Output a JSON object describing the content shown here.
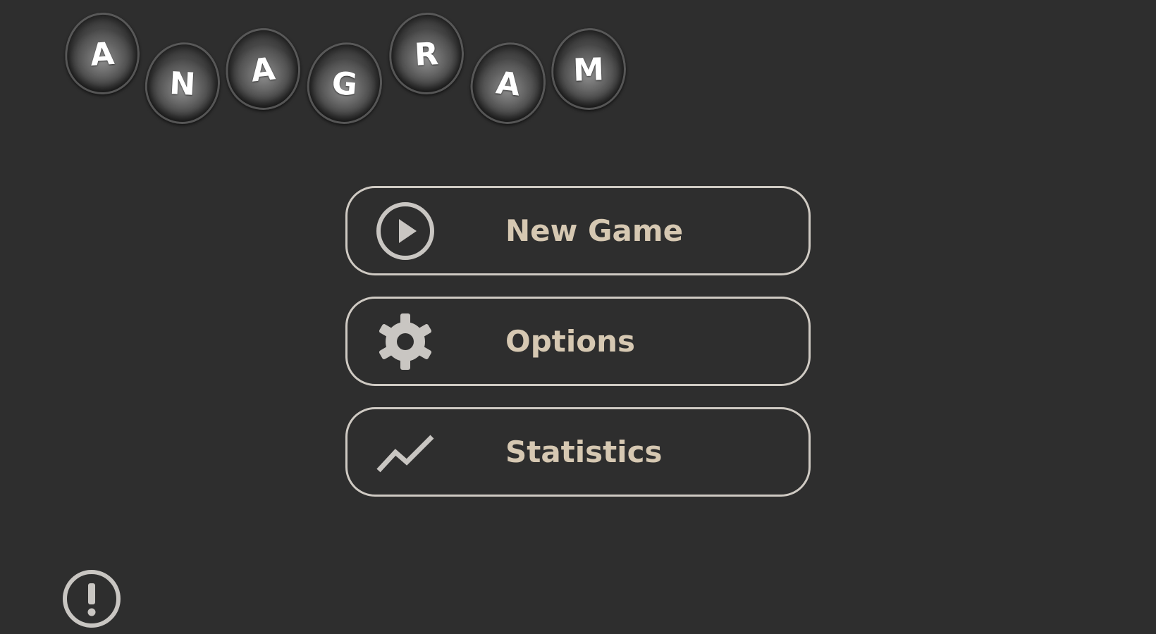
{
  "logo": {
    "letters": [
      "A",
      "N",
      "A",
      "G",
      "R",
      "A",
      "M"
    ]
  },
  "menu": {
    "new_game_label": "New Game",
    "options_label": "Options",
    "statistics_label": "Statistics"
  },
  "icons": {
    "new_game": "play-circle-icon",
    "options": "gear-icon",
    "statistics": "trend-line-icon",
    "info": "exclamation-circle-icon"
  },
  "colors": {
    "background": "#2e2e2e",
    "button_border": "#cfcac3",
    "button_text": "#d6c8b2",
    "icon": "#c9c6c2"
  }
}
